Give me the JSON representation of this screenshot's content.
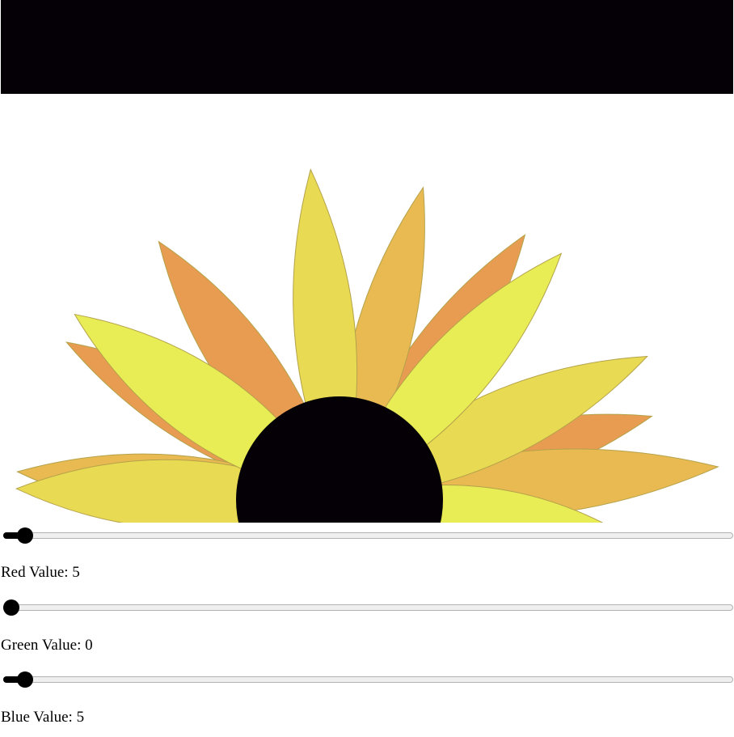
{
  "canvas": {
    "top_bar_color": "#040005",
    "center_color": "#040005",
    "petal_colors": [
      "#e89c52",
      "#e9ba52",
      "#e8da52",
      "#e8ec55"
    ],
    "petal_stroke": "#b4a24a"
  },
  "controls": [
    {
      "key": "red",
      "label": "Red Value: 5",
      "value": 5,
      "max": 255
    },
    {
      "key": "green",
      "label": "Green Value: 0",
      "value": 0,
      "max": 255
    },
    {
      "key": "blue",
      "label": "Blue Value: 5",
      "value": 5,
      "max": 255
    }
  ]
}
